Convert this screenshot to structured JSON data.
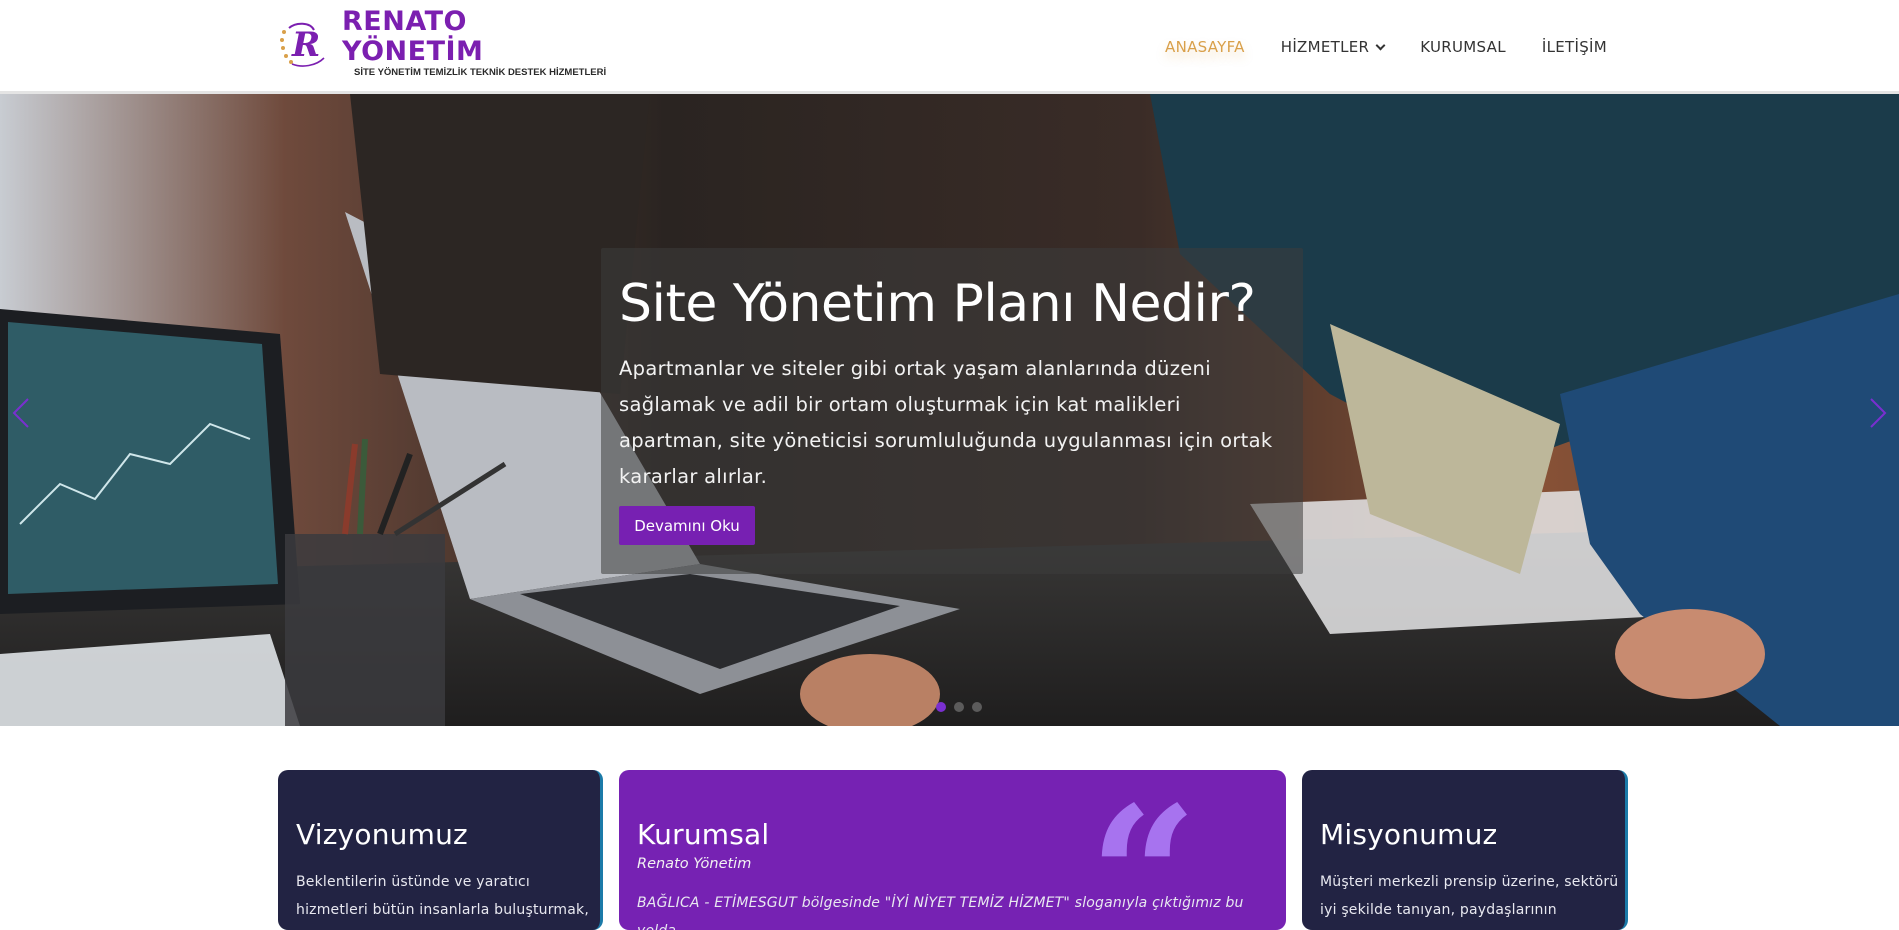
{
  "header": {
    "logo_title": "RENATO YÖNETİM",
    "logo_subtitle": "SİTE YÖNETİM TEMİZLİK TEKNİK DESTEK HİZMETLERİ",
    "nav": [
      {
        "label": "ANASAYFA",
        "active": true
      },
      {
        "label": "HİZMETLER",
        "has_dropdown": true
      },
      {
        "label": "KURUMSAL"
      },
      {
        "label": "İLETİŞİM"
      }
    ]
  },
  "hero": {
    "title": "Site Yönetim Planı Nedir?",
    "text": "Apartmanlar ve siteler gibi ortak yaşam alanlarında düzeni sağlamak ve adil bir ortam oluşturmak için kat malikleri apartman, site yöneticisi sorumluluğunda uygulanması için ortak kararlar alırlar.",
    "button_label": "Devamını Oku",
    "slide_count": 3,
    "active_slide": 1,
    "prev_icon": "chevron-left-icon",
    "next_icon": "chevron-right-icon"
  },
  "cards": [
    {
      "title": "Vizyonumuz",
      "body": "Beklentilerin üstünde ve yaratıcı hizmetleri bütün insanlarla buluşturmak,"
    },
    {
      "title": "Kurumsal",
      "subtitle": "Renato Yönetim",
      "body": "BAĞLICA - ETİMESGUT bölgesinde \"İYİ NİYET TEMİZ HİZMET\" sloganıyla çıktığımız bu yolda,",
      "icon": "quote-icon"
    },
    {
      "title": "Misyonumuz",
      "body": "Müşteri merkezli prensip üzerine, sektörü iyi şekilde tanıyan, paydaşlarının"
    }
  ],
  "colors": {
    "brand_purple": "#7622b3",
    "nav_active": "#d9a04a",
    "card_dark": "#222343",
    "quote_light": "#a773ef"
  }
}
